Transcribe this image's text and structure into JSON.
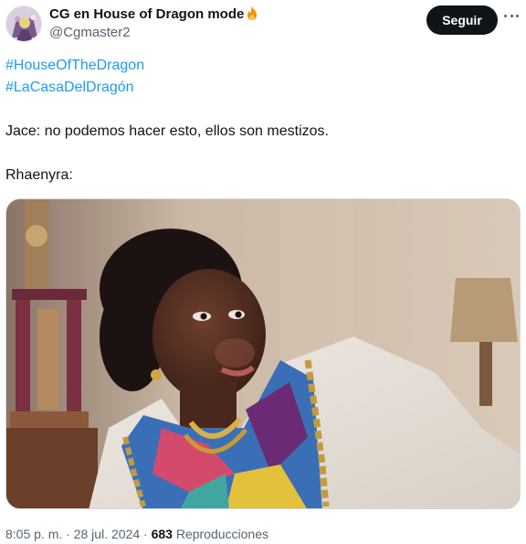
{
  "tweet": {
    "author": {
      "display_name": "CG en House of Dragon mode",
      "handle": "@Cgmaster2",
      "badge_icon": "fire-icon"
    },
    "follow_label": "Seguir",
    "hashtags": [
      "#HouseOfTheDragon",
      "#LaCasaDelDragón"
    ],
    "lines": [
      "Jace: no podemos hacer esto, ellos son mestizos.",
      "Rhaenyra:"
    ],
    "meta": {
      "time": "8:05 p. m.",
      "separator": "·",
      "date": "28 jul. 2024",
      "views_count": "683",
      "views_label": "Reproducciones"
    }
  },
  "colors": {
    "accent": "#1d9bf0",
    "button_bg": "#0f1419",
    "secondary_text": "#536471"
  }
}
